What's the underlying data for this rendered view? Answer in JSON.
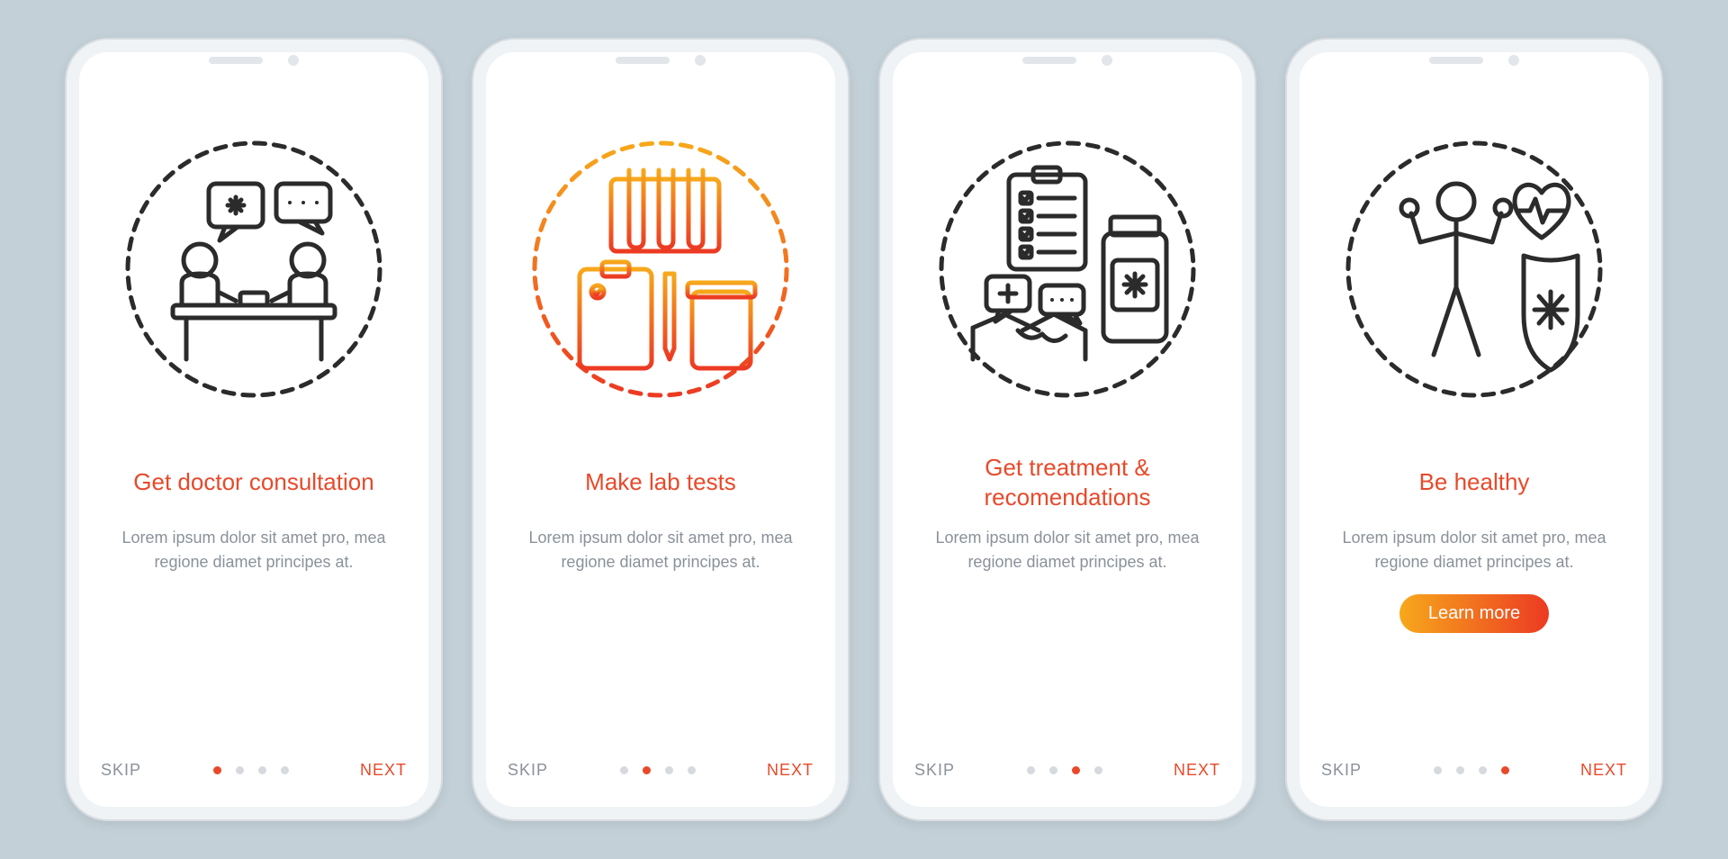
{
  "colors": {
    "accent": "#e8492a",
    "accent_gradient_start": "#f7a81b",
    "accent_gradient_end": "#ec3a23",
    "muted": "#8a9199",
    "background": "#c3d0d8",
    "line_dark": "#2b2b2b"
  },
  "screens": [
    {
      "icon": "doctor-consultation-icon",
      "icon_color": "dark",
      "title": "Get doctor consultation",
      "description": "Lorem ipsum dolor sit amet pro, mea regione diamet principes at.",
      "active_index": 0,
      "has_cta": false
    },
    {
      "icon": "lab-tests-icon",
      "icon_color": "orange",
      "title": "Make lab tests",
      "description": "Lorem ipsum dolor sit amet pro, mea regione diamet principes at.",
      "active_index": 1,
      "has_cta": false
    },
    {
      "icon": "treatment-icon",
      "icon_color": "dark",
      "title": "Get treatment & recomendations",
      "description": "Lorem ipsum dolor sit amet pro, mea regione diamet principes at.",
      "active_index": 2,
      "has_cta": false
    },
    {
      "icon": "healthy-icon",
      "icon_color": "dark",
      "title": "Be healthy",
      "description": "Lorem ipsum dolor sit amet pro, mea regione diamet principes at.",
      "active_index": 3,
      "has_cta": true
    }
  ],
  "buttons": {
    "skip": "SKIP",
    "next": "NEXT",
    "cta": "Learn more"
  },
  "pagination": {
    "total_dots": 4
  }
}
